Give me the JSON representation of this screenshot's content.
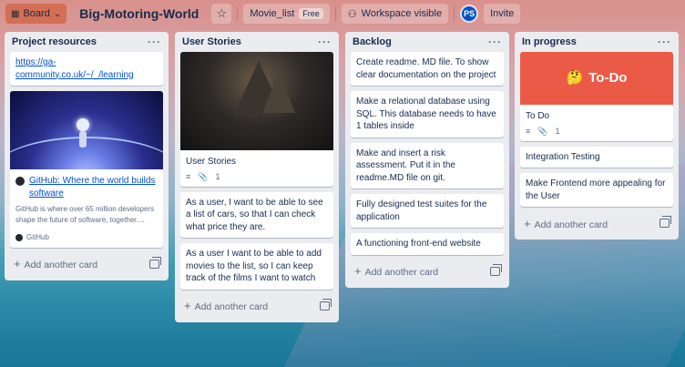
{
  "topbar": {
    "board_switch_label": "Board",
    "board_title": "Big-Motoring-World",
    "star_icon": "star-icon",
    "template_label": "Movie_list",
    "template_badge": "Free",
    "visibility_label": "Workspace visible",
    "avatar_initials": "PS",
    "invite_label": "Invite"
  },
  "lists": [
    {
      "title": "Project resources",
      "cards": [
        {
          "text": "https://ga-community.co.uk/~/_/learning"
        },
        {
          "title": "GitHub: Where the world builds software",
          "desc": "GitHub is where over 65 million developers shape the future of software, together....",
          "source": "GitHub"
        }
      ],
      "add_label": "Add another card"
    },
    {
      "title": "User Stories",
      "cards": [
        {
          "text": "User Stories",
          "attachments": "1"
        },
        {
          "text": "As a user, I want to be able to see a list of cars, so that I can check what price they are."
        },
        {
          "text": "As a user I want to be able to add movies to the list, so I can keep track of the films I want to watch"
        }
      ],
      "add_label": "Add another card"
    },
    {
      "title": "Backlog",
      "cards": [
        {
          "text": "Create readme. MD file. To show clear documentation on the project"
        },
        {
          "text": "Make a relational database using SQL. This database needs to have 1 tables inside"
        },
        {
          "text": "Make and insert a risk assessment. Put it in the readme.MD file on git."
        },
        {
          "text": "Fully designed test suites for the application"
        },
        {
          "text": "A functioning front-end website"
        }
      ],
      "add_label": "Add another card"
    },
    {
      "title": "In progress",
      "cards": [
        {
          "cover_text": "To-Do",
          "cover_emoji": "🤔",
          "text": "To Do",
          "attachments": "1"
        },
        {
          "text": "Integration Testing"
        },
        {
          "text": "Make Frontend more appealing for the User"
        }
      ],
      "add_label": "Add another card"
    }
  ],
  "colors": {
    "board_button": "#d46e55",
    "list_bg": "#ebecf0",
    "cover_red": "#eb5a46",
    "link_blue": "#0052cc"
  }
}
